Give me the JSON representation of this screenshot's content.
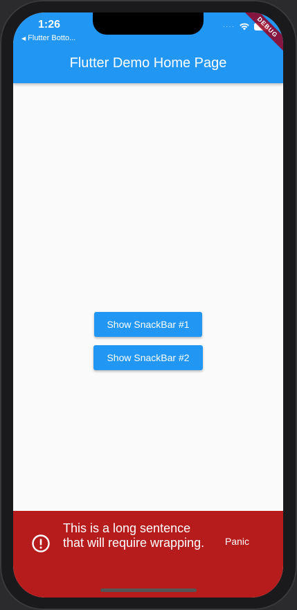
{
  "status_bar": {
    "time": "1:26",
    "back_app": "Flutter Botto..."
  },
  "debug_banner": "DEBUG",
  "app_bar": {
    "title": "Flutter Demo Home Page",
    "color": "#2196f3"
  },
  "buttons": {
    "snackbar1": "Show SnackBar #1",
    "snackbar2": "Show SnackBar #2"
  },
  "snackbar": {
    "icon": "error-outline-icon",
    "message": "This is a long sentence that will require wrapping.",
    "action": "Panic",
    "color": "#b71c1c"
  }
}
